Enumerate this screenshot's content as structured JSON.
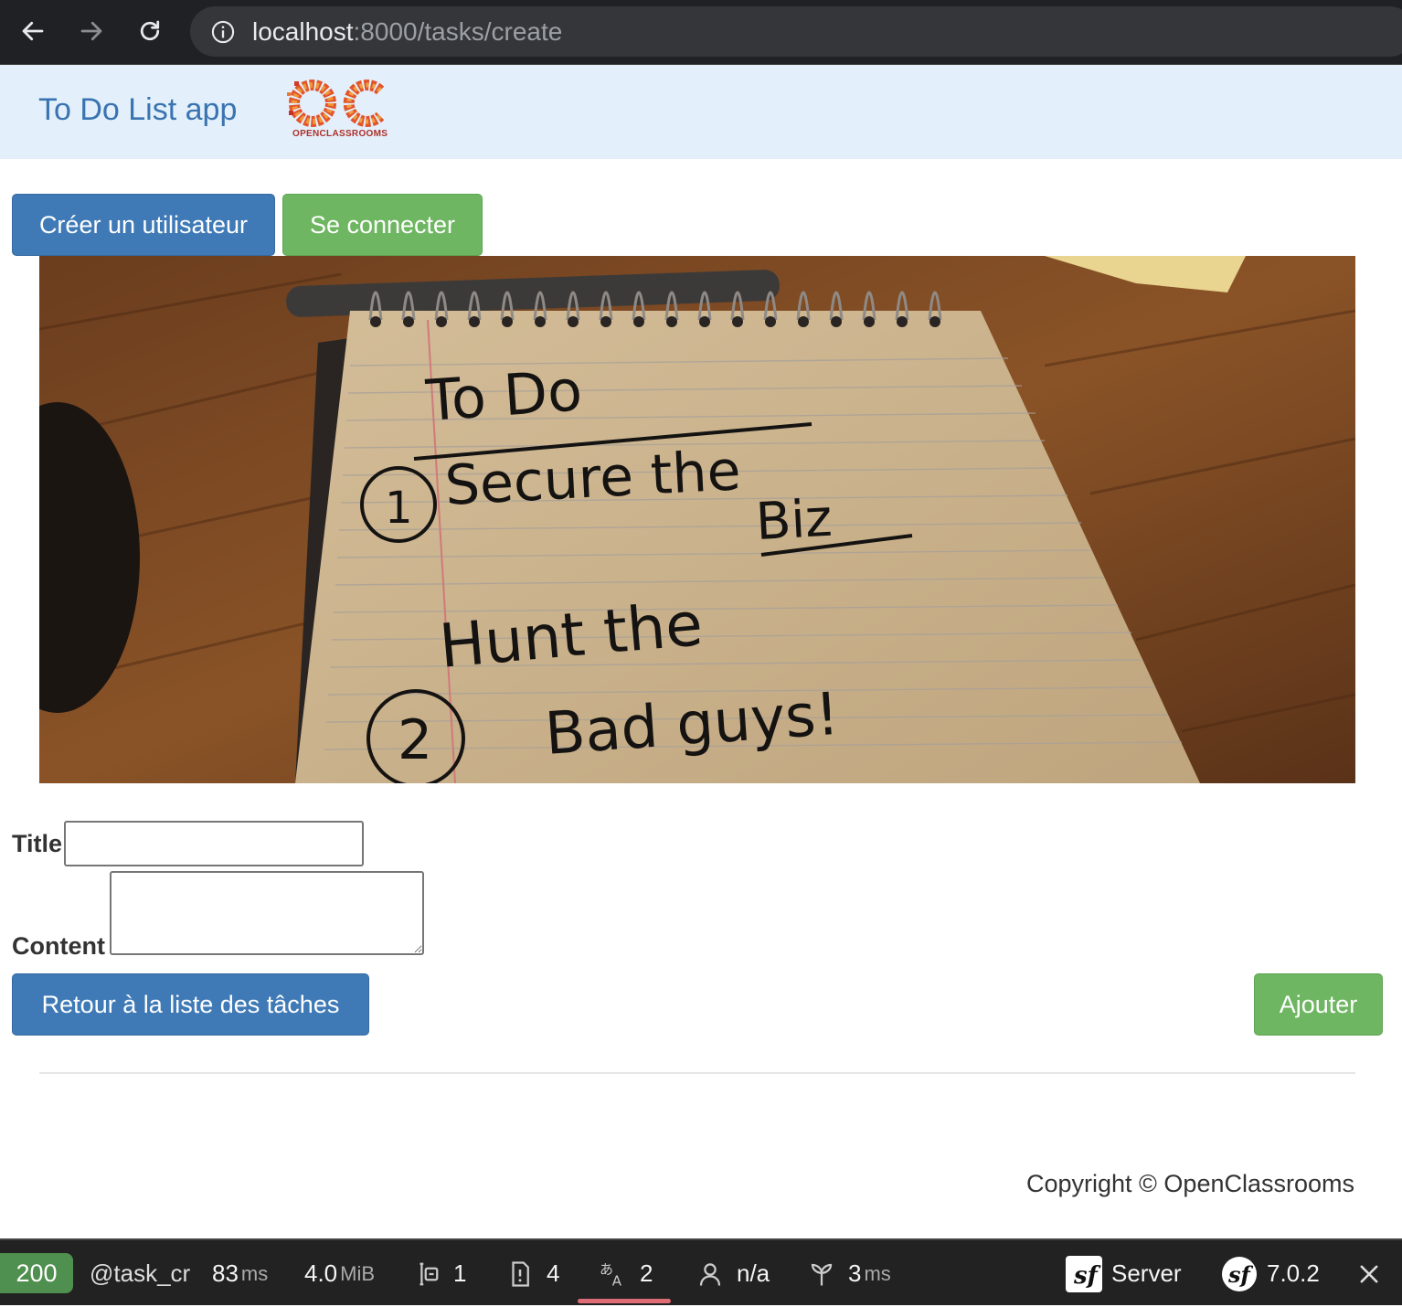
{
  "browser": {
    "url_host": "localhost",
    "url_path": ":8000/tasks/create"
  },
  "navbar": {
    "brand": "To Do List app",
    "logo_caption": "OPENCLASSROOMS"
  },
  "top_buttons": {
    "create_user": "Créer un utilisateur",
    "login": "Se connecter"
  },
  "hero": {
    "note_lines": [
      "To Do",
      "Secure the",
      "Biz",
      "Hunt the",
      "Bad guys!"
    ],
    "numbers": [
      "1",
      "2"
    ]
  },
  "form": {
    "title_label": "Title",
    "title_value": "",
    "content_label": "Content",
    "content_value": ""
  },
  "actions": {
    "back": "Retour à la liste des tâches",
    "submit": "Ajouter"
  },
  "footer": {
    "copyright": "Copyright © OpenClassrooms"
  },
  "symfony_toolbar": {
    "status": "200",
    "route": "@task_cr",
    "time_value": "83",
    "time_unit": "ms",
    "memory_value": "4.0",
    "memory_unit": "MiB",
    "forms_count": "1",
    "logs_count": "4",
    "translations_count": "2",
    "user": "n/a",
    "twig_value": "3",
    "twig_unit": "ms",
    "server_label": "Server",
    "symfony_version": "7.0.2"
  },
  "colors": {
    "primary": "#3f7ab6",
    "success": "#6eb661",
    "navbar_bg": "#e3f0fb",
    "brand_text": "#3a74b0",
    "status_ok": "#4f8f4f"
  }
}
